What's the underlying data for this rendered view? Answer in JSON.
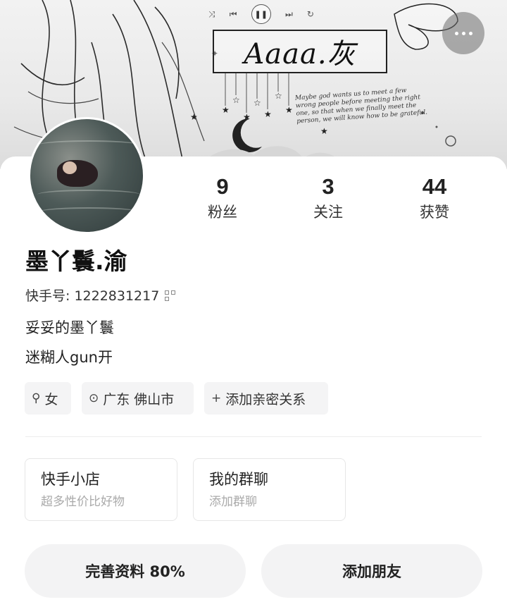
{
  "banner": {
    "title": "Aaaa.灰",
    "quote": "Maybe god wants us to meet a few wrong people before meeting the right one, so that when we finally meet the person, we will know how to be grateful."
  },
  "media": {
    "shuffle_icon": "shuffle-icon",
    "prev_icon": "skip-previous-icon",
    "pause_icon": "pause-icon",
    "next_icon": "skip-next-icon",
    "repeat_icon": "repeat-icon"
  },
  "more_icon": "more-horizontal-icon",
  "stats": [
    {
      "value": "9",
      "label": "粉丝"
    },
    {
      "value": "3",
      "label": "关注"
    },
    {
      "value": "44",
      "label": "获赞"
    }
  ],
  "profile": {
    "username": "墨丫鬟.渝",
    "kuaishou_id": "快手号: 1222831217",
    "bio": [
      "妥妥的墨丫鬟",
      "迷糊人gun开"
    ]
  },
  "tags": [
    {
      "icon": "female-icon",
      "label": "女"
    },
    {
      "icon": "location-pin-icon",
      "label": "广东 佛山市"
    },
    {
      "icon": "plus-icon",
      "label": "添加亲密关系"
    }
  ],
  "features": [
    {
      "title": "快手小店",
      "subtitle": "超多性价比好物"
    },
    {
      "title": "我的群聊",
      "subtitle": "添加群聊"
    }
  ],
  "actions": {
    "complete_profile": "完善资料 80%",
    "add_friend": "添加朋友"
  },
  "colors": {
    "background": "#ffffff",
    "chip_bg": "#f4f4f5",
    "pill_bg": "#f3f3f4",
    "muted_text": "#aaaaaa",
    "more_button_bg": "#6e6e6e"
  }
}
